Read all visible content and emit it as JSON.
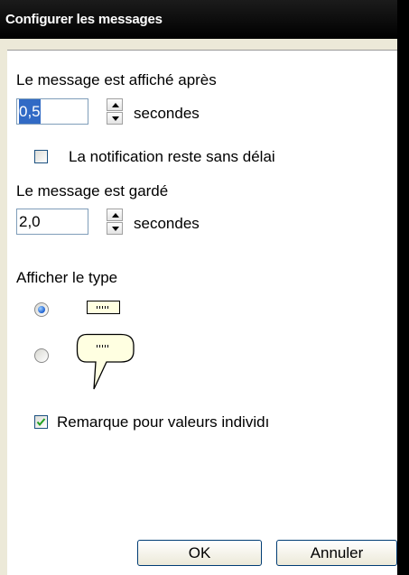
{
  "window": {
    "title": "Configurer les messages"
  },
  "delay_display": {
    "label": "Le message est affiché après",
    "value": "0,5",
    "unit": "secondes"
  },
  "no_timeout": {
    "label": "La notification reste sans délai",
    "checked": false
  },
  "delay_keep": {
    "label": "Le message est gardé",
    "value": "2,0",
    "unit": "secondes"
  },
  "display_type": {
    "label": "Afficher le type",
    "options": [
      {
        "style": "tooltip-box-icon",
        "selected": true
      },
      {
        "style": "speech-bubble-icon",
        "selected": false
      }
    ]
  },
  "remark_single": {
    "label": "Remarque pour valeurs individı",
    "checked": true
  },
  "buttons": {
    "ok": "OK",
    "cancel": "Annuler"
  },
  "colors": {
    "accent": "#316ac5",
    "check": "#21a121",
    "tooltip_fill": "#ffffe1"
  }
}
